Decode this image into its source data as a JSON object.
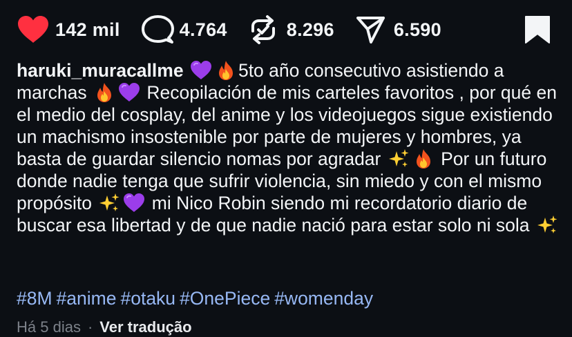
{
  "actions": {
    "likes": {
      "icon": "heart-icon",
      "count": "142 mil",
      "color": "#ff3040"
    },
    "comments": {
      "icon": "comment-icon",
      "count": "4.764"
    },
    "reposts": {
      "icon": "repost-icon",
      "count": "8.296"
    },
    "shares": {
      "icon": "send-icon",
      "count": "6.590"
    },
    "save": {
      "icon": "bookmark-icon"
    }
  },
  "caption": {
    "username": "haruki_muracallme",
    "segments": [
      {
        "type": "emoji",
        "icon": "purple-heart-emoji"
      },
      {
        "type": "emoji",
        "icon": "fire-emoji"
      },
      {
        "type": "text",
        "value": "5to año consecutivo asistiendo a marchas "
      },
      {
        "type": "emoji",
        "icon": "fire-emoji"
      },
      {
        "type": "emoji",
        "icon": "purple-heart-emoji"
      },
      {
        "type": "text",
        "value": " Recopilación de mis carteles favoritos , por qué en el medio del cosplay, del anime y los videojuegos sigue existiendo un machismo insostenible por parte de mujeres y hombres, ya basta de guardar silencio nomas por agradar "
      },
      {
        "type": "emoji",
        "icon": "sparkles-emoji"
      },
      {
        "type": "emoji",
        "icon": "fire-emoji"
      },
      {
        "type": "text",
        "value": " Por un futuro donde nadie tenga que sufrir violencia, sin miedo y con el mismo propósito "
      },
      {
        "type": "emoji",
        "icon": "sparkles-emoji"
      },
      {
        "type": "emoji",
        "icon": "purple-heart-emoji"
      },
      {
        "type": "text",
        "value": " mi Nico Robin siendo mi recordatorio diario de buscar esa libertad y de que nadie nació para estar solo ni sola "
      },
      {
        "type": "emoji",
        "icon": "sparkles-emoji"
      }
    ]
  },
  "hashtags": [
    "#8M",
    "#anime",
    "#otaku",
    "#OnePiece",
    "#womenday"
  ],
  "footer": {
    "timestamp": "Há 5 dias",
    "separator": "·",
    "translate_label": "Ver tradução"
  },
  "colors": {
    "background": "#0c0f14",
    "text": "#f3f5f7",
    "hashtag": "#97b8f4",
    "muted": "#7d828a",
    "like": "#ff3040"
  }
}
